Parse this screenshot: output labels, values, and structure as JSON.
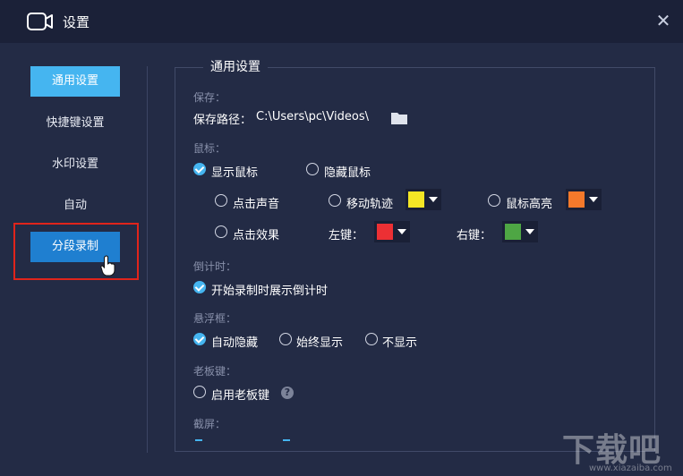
{
  "window": {
    "title": "设置",
    "close_glyph": "✕"
  },
  "sidebar": {
    "items": [
      {
        "label": "通用设置",
        "state": "active"
      },
      {
        "label": "快捷键设置"
      },
      {
        "label": "水印设置"
      },
      {
        "label": "自动"
      },
      {
        "label": "分段录制",
        "state": "hover"
      }
    ]
  },
  "panel": {
    "title": "通用设置",
    "save": {
      "section": "保存：",
      "path_label": "保存路径：",
      "path_value": "C:\\Users\\pc\\Videos\\"
    },
    "mouse": {
      "section": "鼠标：",
      "show_cursor": "显示鼠标",
      "hide_cursor": "隐藏鼠标",
      "click_sound": "点击声音",
      "move_track": "移动轨迹",
      "highlight": "鼠标高亮",
      "click_effect": "点击效果",
      "left_key": "左键：",
      "right_key": "右键："
    },
    "countdown": {
      "section": "倒计时：",
      "show_countdown": "开始录制时展示倒计时"
    },
    "float_box": {
      "section": "悬浮框：",
      "auto_hide": "自动隐藏",
      "always_show": "始终显示",
      "never_show": "不显示"
    },
    "boss_key": {
      "section": "老板键：",
      "enable": "启用老板键",
      "help_glyph": "?"
    },
    "screenshot": {
      "section": "截屏："
    }
  },
  "colors": {
    "accent": "#45b5f0",
    "hover": "#1f7fd0",
    "move_track": "#f5e625",
    "highlight": "#f4792b",
    "left_key": "#ec3034",
    "right_key": "#4ea644",
    "annotation_box": "#e0241b"
  },
  "watermark": {
    "brand": "下载吧",
    "url": "www.xiazaiba.com"
  }
}
